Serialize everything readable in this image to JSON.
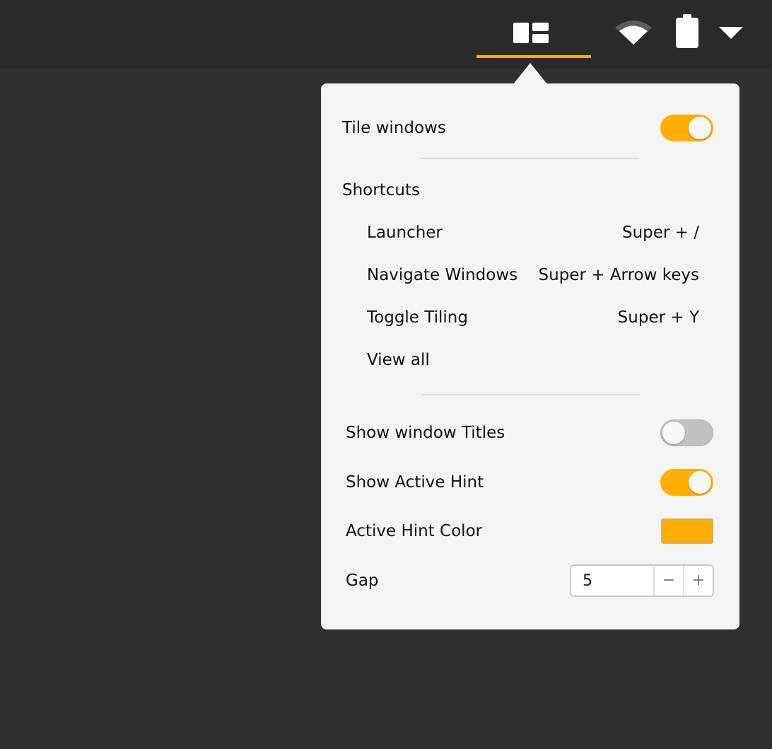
{
  "panel": {
    "tile_windows": {
      "label": "Tile windows",
      "enabled": true
    },
    "shortcuts": {
      "heading": "Shortcuts",
      "items": [
        {
          "label": "Launcher",
          "keys": "Super + /"
        },
        {
          "label": "Navigate Windows",
          "keys": "Super + Arrow keys"
        },
        {
          "label": "Toggle Tiling",
          "keys": "Super + Y"
        }
      ],
      "view_all": "View all"
    },
    "show_window_titles": {
      "label": "Show window Titles",
      "enabled": false
    },
    "show_active_hint": {
      "label": "Show Active Hint",
      "enabled": true
    },
    "active_hint_color": {
      "label": "Active Hint Color",
      "value": "#ffad00"
    },
    "gap": {
      "label": "Gap",
      "value": "5",
      "decrement": "−",
      "increment": "+"
    }
  },
  "topbar": {
    "icons": [
      "tiling-icon",
      "wifi-icon",
      "battery-icon",
      "system-menu-arrow-icon"
    ],
    "active_indicator_color": "#ffad00"
  },
  "colors": {
    "accent": "#ffad00",
    "panel_bg": "#f4f4f4",
    "topbar_bg": "#2a2a2a",
    "desktop_bg": "#303030"
  }
}
